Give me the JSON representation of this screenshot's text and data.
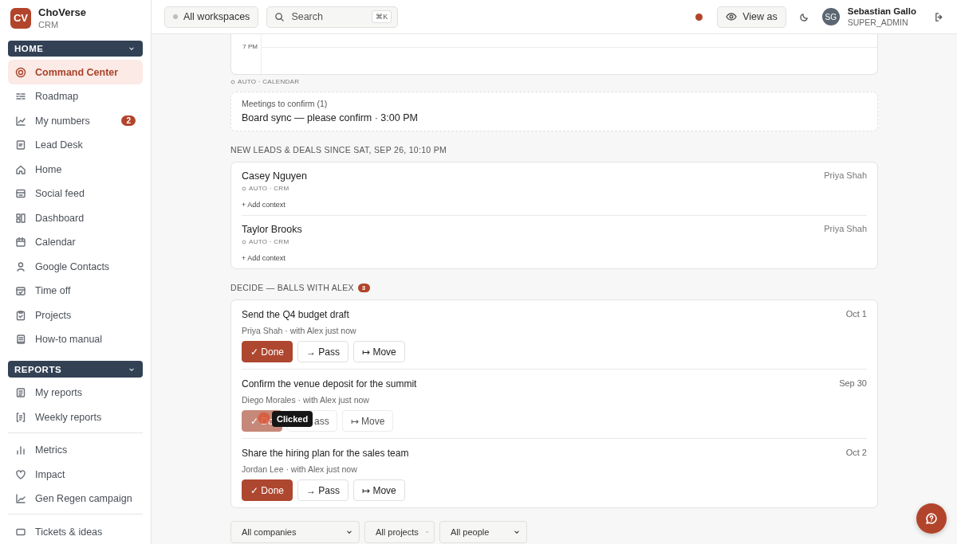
{
  "brand": {
    "logo": "CV",
    "name": "ChoVerse",
    "subtitle": "CRM"
  },
  "sidebar": {
    "sections": [
      {
        "title": "HOME",
        "expanded": true,
        "items": [
          {
            "label": "Command Center",
            "selected": true
          },
          {
            "label": "Roadmap",
            "selected": false
          },
          {
            "label": "My numbers",
            "selected": false,
            "badge": "2"
          },
          {
            "label": "Lead Desk",
            "selected": false
          },
          {
            "label": "Home",
            "selected": false
          },
          {
            "label": "Social feed",
            "selected": false
          },
          {
            "label": "Dashboard",
            "selected": false
          },
          {
            "label": "Calendar",
            "selected": false
          },
          {
            "label": "Google Contacts",
            "selected": false
          },
          {
            "label": "Time off",
            "selected": false
          },
          {
            "label": "Projects",
            "selected": false
          },
          {
            "label": "How-to manual",
            "selected": false
          }
        ]
      },
      {
        "title": "REPORTS",
        "expanded": true,
        "items": [
          {
            "label": "My reports",
            "selected": false
          },
          {
            "label": "Weekly reports",
            "selected": false
          }
        ]
      },
      {
        "items": [
          {
            "label": "Metrics",
            "selected": false
          },
          {
            "label": "Impact",
            "selected": false
          },
          {
            "label": "Gen Regen campaign",
            "selected": false
          }
        ]
      },
      {
        "items": [
          {
            "label": "Tickets & ideas",
            "selected": false
          }
        ]
      }
    ]
  },
  "topbar": {
    "workspace": "All workspaces",
    "search": {
      "placeholder": "Search",
      "shortcut": "⌘K"
    },
    "view_as": "View as",
    "user": {
      "initials": "SG",
      "name": "Sebastian Gallo",
      "role": "SUPER_ADMIN"
    }
  },
  "calendar": {
    "time_label": "7 PM",
    "source": "AUTO · CALENDAR"
  },
  "meetings": {
    "title": "Meetings to confirm (1)",
    "text": "Board sync — please confirm · 3:00 PM"
  },
  "leads": {
    "heading": "NEW LEADS & DEALS SINCE SAT, SEP 26, 10:10 PM",
    "items": [
      {
        "name": "Casey Nguyen",
        "source": "AUTO · CRM",
        "action": "+ Add context",
        "owner": "Priya Shah"
      },
      {
        "name": "Taylor Brooks",
        "source": "AUTO · CRM",
        "action": "+ Add context",
        "owner": "Priya Shah"
      }
    ]
  },
  "decide": {
    "heading": "DECIDE — BALLS WITH ALEX",
    "count": "3",
    "items": [
      {
        "title": "Send the Q4 budget draft",
        "meta": "Priya Shah · with Alex just now",
        "date": "Oct 1",
        "pending": false,
        "buttons": [
          {
            "label": "✓ Done",
            "kind": "primary"
          },
          {
            "label": "→ Pass",
            "kind": "secondary"
          },
          {
            "label": "↦ Move",
            "kind": "secondary"
          }
        ]
      },
      {
        "title": "Confirm the venue deposit for the summit",
        "meta": "Diego Morales · with Alex just now",
        "date": "Sep 30",
        "pending": true,
        "tooltip": "Clicked",
        "buttons": [
          {
            "label": "✓ Do",
            "kind": "primary"
          },
          {
            "label": "ass",
            "kind": "secondary"
          },
          {
            "label": "↦ Move",
            "kind": "secondary"
          }
        ]
      },
      {
        "title": "Share the hiring plan for the sales team",
        "meta": "Jordan Lee · with Alex just now",
        "date": "Oct 2",
        "pending": false,
        "buttons": [
          {
            "label": "✓ Done",
            "kind": "primary"
          },
          {
            "label": "→ Pass",
            "kind": "secondary"
          },
          {
            "label": "↦ Move",
            "kind": "secondary"
          }
        ]
      }
    ]
  },
  "filters": [
    "All companies",
    "All projects",
    "All people"
  ]
}
